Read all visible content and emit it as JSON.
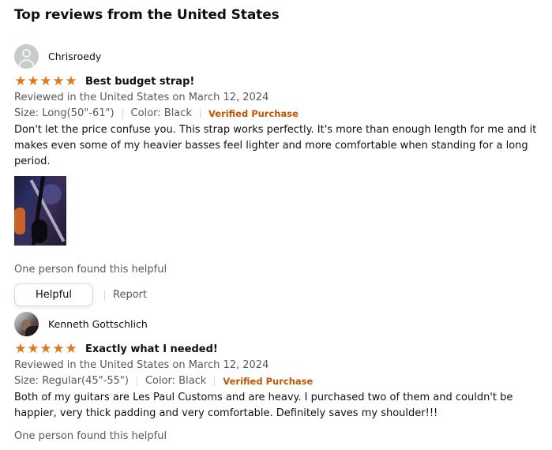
{
  "section": {
    "title": "Top reviews from the United States"
  },
  "reviews": [
    {
      "author": "Chrisroedy",
      "rating": 5,
      "title": "Best budget strap!",
      "reviewed_line": "Reviewed in the United States on March 12, 2024",
      "size": "Size: Long(50\"-61\")",
      "color": "Color: Black",
      "verified": "Verified Purchase",
      "body": "Don't let the price confuse you. This strap works perfectly. It's more than enough length for me and it makes even some of my heavier basses feel lighter and more comfortable when standing for a long period.",
      "helpful": "One person found this helpful",
      "helpful_button": "Helpful",
      "report": "Report"
    },
    {
      "author": "Kenneth Gottschlich",
      "rating": 5,
      "title": "Exactly what I needed!",
      "reviewed_line": "Reviewed in the United States on March 12, 2024",
      "size": "Size: Regular(45\"-55\")",
      "color": "Color: Black",
      "verified": "Verified Purchase",
      "body": "Both of my guitars are Les Paul Customs and are heavy. I purchased two of them and couldn't be happier, very thick padding and very comfortable. Definitely saves my shoulder!!!",
      "helpful": "One person found this helpful"
    }
  ],
  "icons": {
    "star": "star-icon",
    "avatar": "user-avatar-icon"
  },
  "colors": {
    "star": "#de7921",
    "verified": "#c45500",
    "muted": "#565959",
    "text": "#0f1111"
  }
}
